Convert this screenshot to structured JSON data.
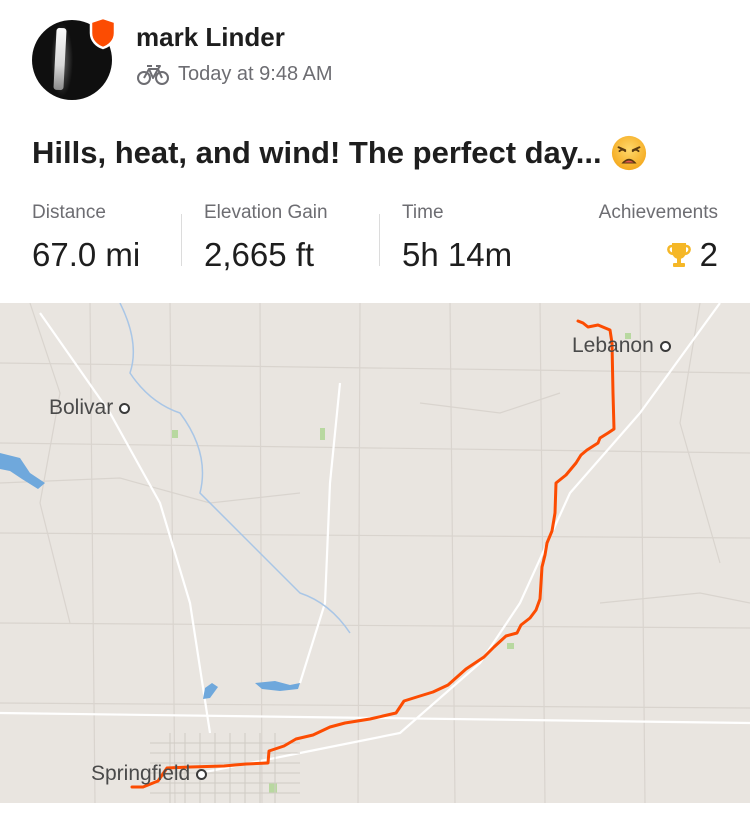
{
  "header": {
    "athlete_name": "mark Linder",
    "activity_icon": "bike-icon",
    "timestamp": "Today at 9:48 AM",
    "badge_color": "#fc4c02"
  },
  "activity": {
    "title": "Hills, heat, and wind!  The perfect day...",
    "title_emoji": "weary-face-emoji"
  },
  "stats": [
    {
      "label": "Distance",
      "value": "67.0 mi"
    },
    {
      "label": "Elevation Gain",
      "value": "2,665 ft"
    },
    {
      "label": "Time",
      "value": "5h 14m"
    },
    {
      "label": "Achievements",
      "value": "2",
      "icon": "trophy-icon"
    }
  ],
  "map": {
    "route_color": "#fc4c02",
    "cities": [
      "Lebanon",
      "Bolivar",
      "Springfield"
    ]
  }
}
